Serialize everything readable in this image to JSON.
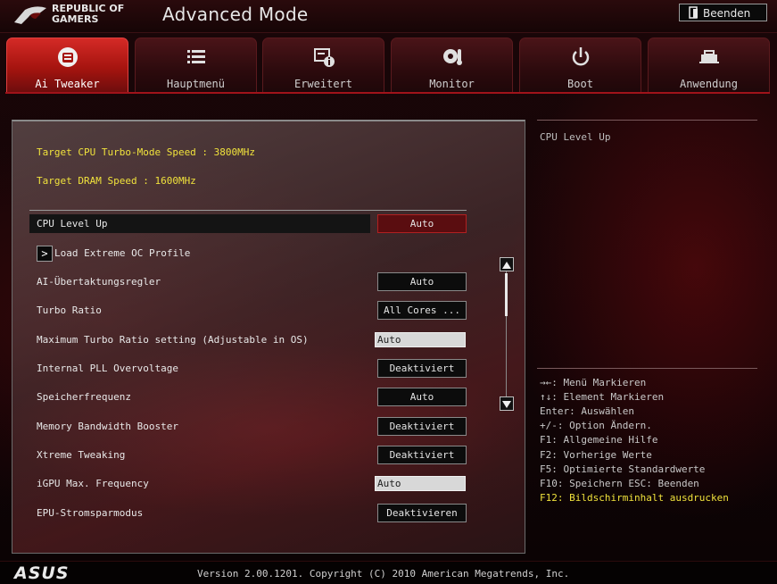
{
  "header": {
    "brand": "REPUBLIC OF\nGAMERS",
    "mode_title": "Advanced Mode",
    "exit_label": "Beenden"
  },
  "tabs": [
    {
      "label": "Ai Tweaker",
      "icon": "thermometer-gauge-icon",
      "active": true
    },
    {
      "label": "Hauptmenü",
      "icon": "list-icon",
      "active": false
    },
    {
      "label": "Erweitert",
      "icon": "info-settings-icon",
      "active": false
    },
    {
      "label": "Monitor",
      "icon": "temperature-monitor-icon",
      "active": false
    },
    {
      "label": "Boot",
      "icon": "power-icon",
      "active": false
    },
    {
      "label": "Anwendung",
      "icon": "tool-icon",
      "active": false
    }
  ],
  "main": {
    "info_cpu": "Target CPU Turbo-Mode Speed : 3800MHz",
    "info_dram": "Target DRAM Speed : 1600MHz",
    "settings": [
      {
        "label": "CPU Level Up",
        "value": "Auto"
      },
      {
        "label": "Load Extreme OC Profile",
        "value": ""
      },
      {
        "label": "AI-Übertaktungsregler",
        "value": "Auto"
      },
      {
        "label": "Turbo Ratio",
        "value": "All Cores ..."
      },
      {
        "label": "Maximum Turbo Ratio setting (Adjustable in OS)",
        "value": "Auto"
      },
      {
        "label": "Internal PLL Overvoltage",
        "value": "Deaktiviert"
      },
      {
        "label": "Speicherfrequenz",
        "value": "Auto"
      },
      {
        "label": "Memory Bandwidth Booster",
        "value": "Deaktiviert"
      },
      {
        "label": "Xtreme Tweaking",
        "value": "Deaktiviert"
      },
      {
        "label": "iGPU Max. Frequency",
        "value": "Auto"
      },
      {
        "label": "EPU-Stromsparmodus",
        "value": "Deaktivieren"
      }
    ],
    "submenu_arrow": ">",
    "scroll_up": "▲",
    "scroll_down": "▼"
  },
  "help": {
    "title": "CPU Level Up",
    "keys": [
      "→←: Menü Markieren",
      "↑↓: Element Markieren",
      "Enter: Auswählen",
      "+/-: Option Ändern.",
      "F1: Allgemeine Hilfe",
      "F2: Vorherige Werte",
      "F5: Optimierte Standardwerte",
      "F10: Speichern  ESC: Beenden",
      "F12: Bildschirminhalt ausdrucken"
    ]
  },
  "footer": {
    "brand": "ASUS",
    "version": "Version 2.00.1201. Copyright (C) 2010 American Megatrends, Inc."
  },
  "colors": {
    "accent": "#c8201c",
    "info_text": "#f0e23c",
    "selected_value_bg": "#5a0d10"
  }
}
